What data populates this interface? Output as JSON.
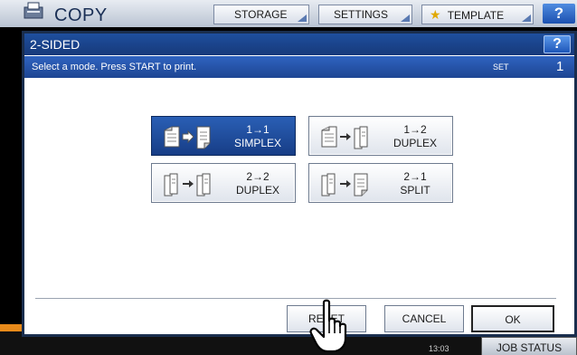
{
  "background": {
    "title": "COPY",
    "tabs": [
      {
        "label": "STORAGE"
      },
      {
        "label": "SETTINGS"
      },
      {
        "label": "TEMPLATE"
      }
    ],
    "help_label": "?",
    "time": "13:03",
    "job_status_label": "JOB STATUS"
  },
  "dialog": {
    "title": "2-SIDED",
    "help_label": "?",
    "message": "Select a mode. Press START to print.",
    "set_label": "SET",
    "set_count": "1",
    "modes": [
      {
        "line1": "1→1",
        "line2": "SIMPLEX",
        "selected": true
      },
      {
        "line1": "1→2",
        "line2": "DUPLEX",
        "selected": false
      },
      {
        "line1": "2→2",
        "line2": "DUPLEX",
        "selected": false
      },
      {
        "line1": "2→1",
        "line2": "SPLIT",
        "selected": false
      }
    ],
    "buttons": {
      "reset": "RESET",
      "cancel": "CANCEL",
      "ok": "OK"
    }
  },
  "colors": {
    "titlebar": "#1e4f9e",
    "selected_button": "#2a5fb5",
    "accent_orange": "#e88a1a"
  }
}
